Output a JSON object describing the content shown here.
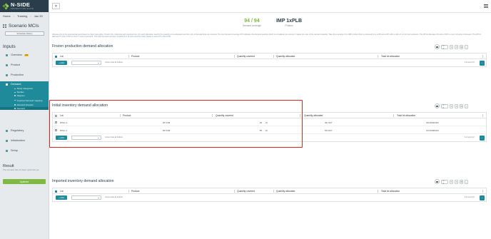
{
  "nav": {
    "home": "Home",
    "training": "Training",
    "date": "Jan 20"
  },
  "logo": {
    "name": "N-SIDE",
    "subtitle": "PRODUCTION SUITE"
  },
  "sidebar": {
    "app_title": "Scenario MCIs",
    "schedule_button": "Schedule history",
    "inputs_title": "Inputs",
    "items": [
      {
        "label": "Overview",
        "badge": "2/3"
      },
      {
        "label": "Product"
      },
      {
        "label": "Production"
      },
      {
        "label": "Demand"
      },
      {
        "label": "Regulatory"
      },
      {
        "label": "Initialization"
      },
      {
        "label": "Setup"
      }
    ],
    "demand_sub": [
      "Study categories",
      "Studies",
      "Regions",
      "Imported demand mapping",
      "Demand forecast",
      "Demand"
    ],
    "result_title": "Result",
    "result_text": "The scenario has not been optimized yet.",
    "optimize_label": "Optimize"
  },
  "header": {
    "close_glyph": "✕",
    "kpi_coverage_value": "94 / 94",
    "kpi_coverage_label": "Demand coverage",
    "kpi_product_value": "IMP 1xPLB",
    "kpi_product_label": "Product"
  },
  "description": "Allocate lots to the selected demand based on their input table. Protect lots, initial lots and imported lots. For each allocation specify the quantity to be allocated and the units of demand that are covered. The top Demand coverage KPI indicates the demand quantity which is considered as covered. It takes the max of the demand quantity. Take the example of an IMP product that is produced from a DP and a DP, with a ratio of 1-1 for both products. The DP lot allocates 20 units of DP to cover 10 units of demand. The DP lot allocated 5 units of DP to cover 5 units of demand. The total demand covered considered is 10 units and the result shows a need of 5 units of DP.",
  "toolbar": {
    "count_label": "0 / 0",
    "count_label_2": "0 / 0"
  },
  "sections": {
    "frozen": {
      "title": "Frozen production demand allocation",
      "columns": [
        "Lot",
        "Product",
        "Quantity covered",
        "Quantity allocated",
        "Total lot allocation"
      ],
      "add_label": "+ Add",
      "move_text": "move rows at bottom",
      "pager": "1-0 out of 0",
      "next": "›"
    },
    "initial": {
      "title": "Initial inventory demand allocation",
      "columns": [
        "Lot",
        "Product",
        "Quantity covered",
        "Quantity allocated",
        "Total lot allocation"
      ],
      "rows": [
        {
          "lot": "DPH1-2",
          "product": "DP PLB",
          "covered": "39",
          "unit": "kit",
          "allocated": "38.7167",
          "total": "181.8000/200"
        },
        {
          "lot": "DPH1-1",
          "product": "DP PLB",
          "covered": "55",
          "unit": "kit",
          "allocated": "55.1657",
          "total": "153.6658/200"
        }
      ],
      "add_label": "+ Add",
      "move_text": "move rows at bottom",
      "pager": "1-2 out of 2",
      "next": "›"
    },
    "imported": {
      "title": "Imported inventory demand allocation",
      "columns": [
        "Lot",
        "Product",
        "Quantity covered",
        "Quantity allocated",
        "Total lot allocation"
      ],
      "add_label": "+ Add",
      "move_text": "move rows at bottom",
      "pager": "1-0 out of 0",
      "next": "›"
    }
  },
  "colors": {
    "accent": "#1f8a99",
    "brand_green": "#7fb842",
    "highlight": "#d9281e",
    "sidebar_dark": "#2a3d4a"
  }
}
